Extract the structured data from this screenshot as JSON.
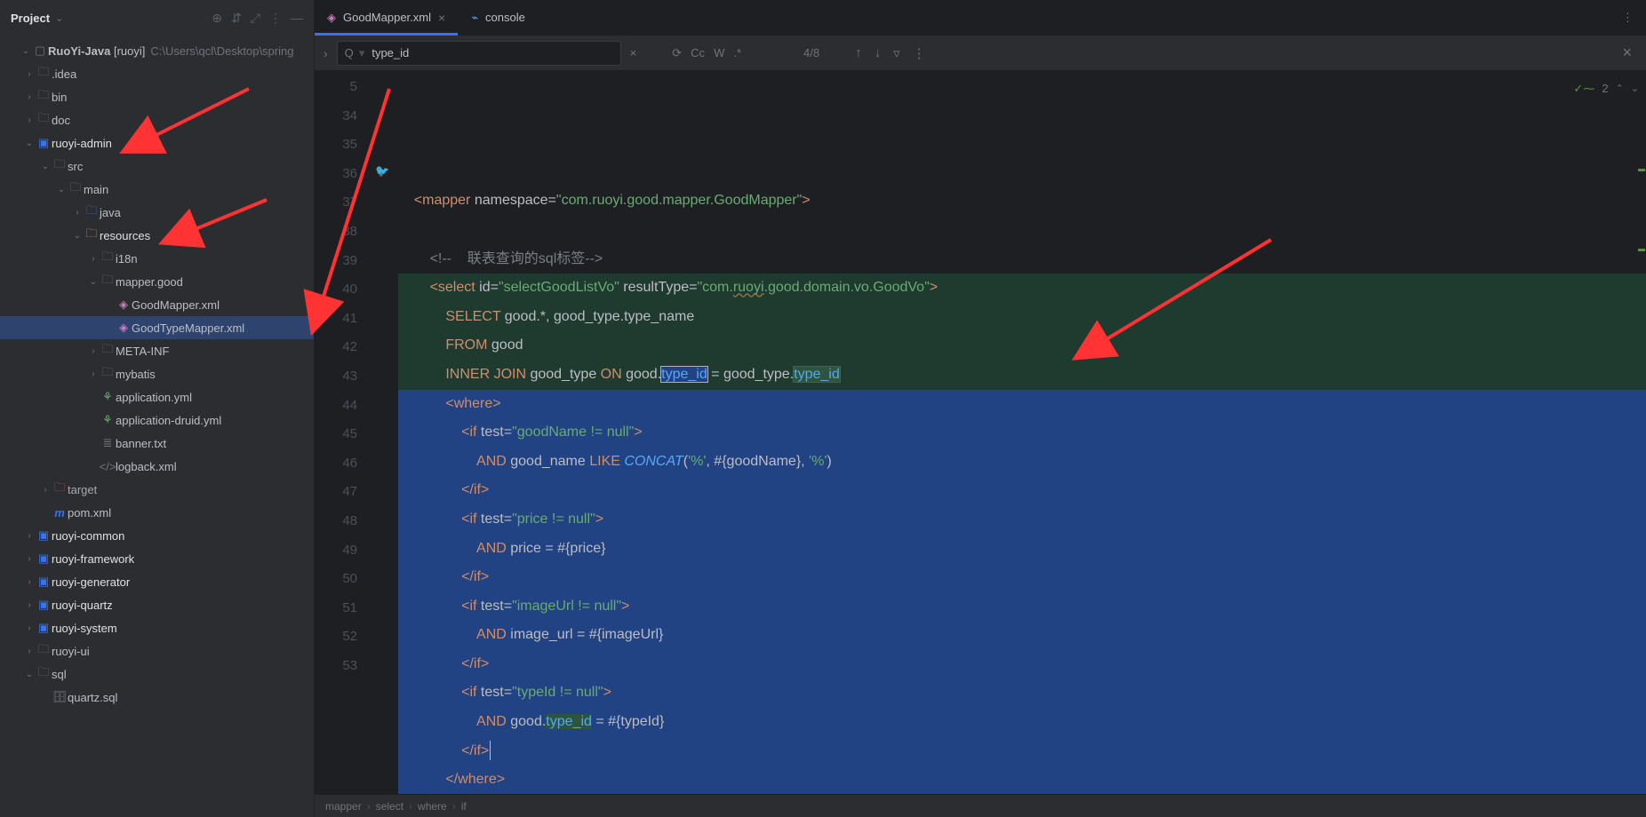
{
  "sidebar": {
    "title": "Project",
    "root": {
      "label": "RuoYi-Java",
      "qualifier": "[ruoyi]",
      "path": "C:\\Users\\qcl\\Desktop\\spring"
    },
    "nodes": [
      {
        "indent": 1,
        "tw": ">",
        "icon": "folder",
        "label": ".idea"
      },
      {
        "indent": 1,
        "tw": ">",
        "icon": "folder",
        "label": "bin"
      },
      {
        "indent": 1,
        "tw": ">",
        "icon": "folder",
        "label": "doc"
      },
      {
        "indent": 1,
        "tw": "v",
        "icon": "module",
        "label": "ruoyi-admin",
        "bold": true
      },
      {
        "indent": 2,
        "tw": "v",
        "icon": "folder",
        "label": "src"
      },
      {
        "indent": 3,
        "tw": "v",
        "icon": "folder",
        "label": "main"
      },
      {
        "indent": 4,
        "tw": ">",
        "icon": "src-folder",
        "label": "java"
      },
      {
        "indent": 4,
        "tw": "v",
        "icon": "res-folder",
        "label": "resources",
        "bold": true
      },
      {
        "indent": 5,
        "tw": ">",
        "icon": "folder",
        "label": "i18n"
      },
      {
        "indent": 5,
        "tw": "v",
        "icon": "folder",
        "label": "mapper.good"
      },
      {
        "indent": 6,
        "tw": "",
        "icon": "xml",
        "label": "GoodMapper.xml"
      },
      {
        "indent": 6,
        "tw": "",
        "icon": "xml",
        "label": "GoodTypeMapper.xml",
        "sel": true
      },
      {
        "indent": 5,
        "tw": ">",
        "icon": "folder",
        "label": "META-INF"
      },
      {
        "indent": 5,
        "tw": ">",
        "icon": "folder",
        "label": "mybatis"
      },
      {
        "indent": 5,
        "tw": "",
        "icon": "yml",
        "label": "application.yml"
      },
      {
        "indent": 5,
        "tw": "",
        "icon": "yml",
        "label": "application-druid.yml"
      },
      {
        "indent": 5,
        "tw": "",
        "icon": "txt",
        "label": "banner.txt"
      },
      {
        "indent": 5,
        "tw": "",
        "icon": "code",
        "label": "logback.xml"
      },
      {
        "indent": 2,
        "tw": ">",
        "icon": "folder-excl",
        "label": "target",
        "dim": true
      },
      {
        "indent": 2,
        "tw": "",
        "icon": "maven",
        "label": "pom.xml"
      },
      {
        "indent": 1,
        "tw": ">",
        "icon": "module",
        "label": "ruoyi-common",
        "bold": true
      },
      {
        "indent": 1,
        "tw": ">",
        "icon": "module",
        "label": "ruoyi-framework",
        "bold": true
      },
      {
        "indent": 1,
        "tw": ">",
        "icon": "module",
        "label": "ruoyi-generator",
        "bold": true
      },
      {
        "indent": 1,
        "tw": ">",
        "icon": "module",
        "label": "ruoyi-quartz",
        "bold": true
      },
      {
        "indent": 1,
        "tw": ">",
        "icon": "module",
        "label": "ruoyi-system",
        "bold": true
      },
      {
        "indent": 1,
        "tw": ">",
        "icon": "folder",
        "label": "ruoyi-ui"
      },
      {
        "indent": 1,
        "tw": "v",
        "icon": "folder",
        "label": "sql"
      },
      {
        "indent": 2,
        "tw": "",
        "icon": "db",
        "label": "quartz.sql"
      }
    ]
  },
  "tabs": [
    {
      "icon": "xml",
      "label": "GoodMapper.xml",
      "active": true,
      "close": true
    },
    {
      "icon": "console",
      "label": "console",
      "active": false,
      "close": false
    }
  ],
  "find": {
    "value": "type_id",
    "count": "4/8",
    "opts": [
      "Cc",
      "W",
      ".*"
    ]
  },
  "annotations": {
    "problems": "2"
  },
  "gutter_start": 5,
  "gutter_lines": [
    "5",
    "34",
    "35",
    "36",
    "37",
    "38",
    "39",
    "40",
    "41",
    "42",
    "43",
    "44",
    "45",
    "46",
    "47",
    "48",
    "49",
    "50",
    "51",
    "52",
    "53"
  ],
  "code": {
    "l5": {
      "pre": "    ",
      "parts": [
        [
          "<",
          "t-tag"
        ],
        [
          "mapper ",
          "t-tag"
        ],
        [
          "namespace",
          "t-attr"
        ],
        [
          "=",
          "t-op"
        ],
        [
          "\"com.ruoyi.good.mapper.GoodMapper\"",
          "t-str"
        ],
        [
          ">",
          "t-tag"
        ]
      ]
    },
    "l34": {
      "pre": "",
      "parts": []
    },
    "l35": {
      "pre": "        ",
      "parts": [
        [
          "<!--    联表查询的sql标签-->",
          "t-cmt"
        ]
      ]
    },
    "l36": {
      "pre": "        ",
      "parts": [
        [
          "<",
          "t-tag"
        ],
        [
          "select ",
          "t-tag"
        ],
        [
          "id",
          "t-attr"
        ],
        [
          "=",
          "t-op"
        ],
        [
          "\"selectGoodListVo\"",
          "t-str"
        ],
        [
          " ",
          "t-txt"
        ],
        [
          "resultType",
          "t-attr"
        ],
        [
          "=",
          "t-op"
        ],
        [
          "\"com.",
          "t-str"
        ],
        [
          "ruoyi",
          "t-str t-wavy"
        ],
        [
          ".good.domain.vo.GoodVo\"",
          "t-str"
        ],
        [
          ">",
          "t-tag"
        ]
      ],
      "hl": "green"
    },
    "l37": {
      "pre": "            ",
      "parts": [
        [
          "SELECT",
          "t-kw"
        ],
        [
          " good.*, good_type.type_name",
          "t-txt"
        ]
      ],
      "hl": "green"
    },
    "l38": {
      "pre": "            ",
      "parts": [
        [
          "FROM",
          "t-kw"
        ],
        [
          " good",
          "t-txt"
        ]
      ],
      "hl": "green"
    },
    "l39": {
      "pre": "            ",
      "parts": [
        [
          "INNER",
          "t-kw"
        ],
        [
          " ",
          "t-txt"
        ],
        [
          "JOIN",
          "t-kw"
        ],
        [
          " good_type ",
          "t-txt"
        ],
        [
          "ON",
          "t-kw"
        ],
        [
          " good.",
          "t-txt"
        ],
        [
          "type_id",
          "t-id boxsel"
        ],
        [
          " = good_type.",
          "t-txt"
        ],
        [
          "type_id",
          "t-id hlbox"
        ]
      ],
      "hl": "green"
    },
    "l40": {
      "pre": "            ",
      "parts": [
        [
          "<",
          "t-tag"
        ],
        [
          "where",
          "t-tag"
        ],
        [
          ">",
          "t-tag"
        ]
      ],
      "sel": true
    },
    "l41": {
      "pre": "                ",
      "parts": [
        [
          "<",
          "t-tag"
        ],
        [
          "if ",
          "t-tag"
        ],
        [
          "test",
          "t-attr"
        ],
        [
          "=",
          "t-op"
        ],
        [
          "\"goodName != null\"",
          "t-str"
        ],
        [
          ">",
          "t-tag"
        ]
      ],
      "sel": true
    },
    "l42": {
      "pre": "                    ",
      "parts": [
        [
          "AND",
          "t-kw"
        ],
        [
          " good_name ",
          "t-txt"
        ],
        [
          "LIKE",
          "t-kw"
        ],
        [
          " ",
          "t-txt"
        ],
        [
          "CONCAT",
          "t-fn"
        ],
        [
          "(",
          "t-txt"
        ],
        [
          "'%'",
          "t-str"
        ],
        [
          ", #{goodName}, ",
          "t-txt"
        ],
        [
          "'%'",
          "t-str"
        ],
        [
          ")",
          "t-txt"
        ]
      ],
      "sel": true
    },
    "l43": {
      "pre": "                ",
      "parts": [
        [
          "</",
          "t-tag"
        ],
        [
          "if",
          "t-tag"
        ],
        [
          ">",
          "t-tag"
        ]
      ],
      "sel": true
    },
    "l44": {
      "pre": "                ",
      "parts": [
        [
          "<",
          "t-tag"
        ],
        [
          "if ",
          "t-tag"
        ],
        [
          "test",
          "t-attr"
        ],
        [
          "=",
          "t-op"
        ],
        [
          "\"price != null\"",
          "t-str"
        ],
        [
          ">",
          "t-tag"
        ]
      ],
      "sel": true
    },
    "l45": {
      "pre": "                    ",
      "parts": [
        [
          "AND",
          "t-kw"
        ],
        [
          " price = #{price}",
          "t-txt"
        ]
      ],
      "sel": true
    },
    "l46": {
      "pre": "                ",
      "parts": [
        [
          "</",
          "t-tag"
        ],
        [
          "if",
          "t-tag"
        ],
        [
          ">",
          "t-tag"
        ]
      ],
      "sel": true
    },
    "l47": {
      "pre": "                ",
      "parts": [
        [
          "<",
          "t-tag"
        ],
        [
          "if ",
          "t-tag"
        ],
        [
          "test",
          "t-attr"
        ],
        [
          "=",
          "t-op"
        ],
        [
          "\"imageUrl != null\"",
          "t-str"
        ],
        [
          ">",
          "t-tag"
        ]
      ],
      "sel": true
    },
    "l48": {
      "pre": "                    ",
      "parts": [
        [
          "AND",
          "t-kw"
        ],
        [
          " image_url = #{imageUrl}",
          "t-txt"
        ]
      ],
      "sel": true
    },
    "l49": {
      "pre": "                ",
      "parts": [
        [
          "</",
          "t-tag"
        ],
        [
          "if",
          "t-tag"
        ],
        [
          ">",
          "t-tag"
        ]
      ],
      "sel": true
    },
    "l50": {
      "pre": "                ",
      "parts": [
        [
          "<",
          "t-tag"
        ],
        [
          "if ",
          "t-tag"
        ],
        [
          "test",
          "t-attr"
        ],
        [
          "=",
          "t-op"
        ],
        [
          "\"typeId != null\"",
          "t-str"
        ],
        [
          ">",
          "t-tag"
        ]
      ],
      "sel": true
    },
    "l51": {
      "pre": "                    ",
      "parts": [
        [
          "AND",
          "t-kw"
        ],
        [
          " good.",
          "t-txt"
        ],
        [
          "type_id",
          "t-id hlbox2"
        ],
        [
          " = #{typeId}",
          "t-txt"
        ]
      ],
      "sel": true
    },
    "l52": {
      "pre": "                ",
      "parts": [
        [
          "</",
          "t-tag"
        ],
        [
          "if",
          "t-tag"
        ],
        [
          ">",
          "t-tag"
        ]
      ],
      "sel": true,
      "caret": true,
      "bulb": true
    },
    "l53": {
      "pre": "            ",
      "parts": [
        [
          "</",
          "t-tag"
        ],
        [
          "where",
          "t-tag"
        ],
        [
          ">",
          "t-tag"
        ]
      ],
      "sel": true
    }
  },
  "crumbs": [
    "mapper",
    "select",
    "where",
    "if"
  ]
}
